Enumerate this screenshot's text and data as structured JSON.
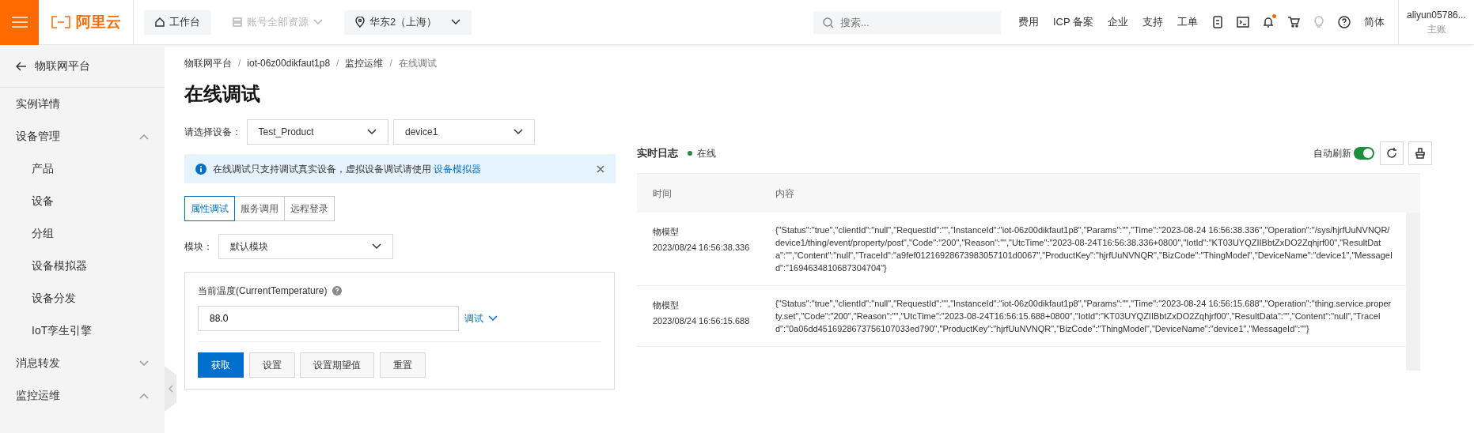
{
  "topbar": {
    "logo": "阿里云",
    "workbench": "工作台",
    "resources": {
      "label": "账号全部资源",
      "disabled": true
    },
    "region": "华东2（上海）",
    "search": {
      "placeholder": "搜索..."
    },
    "links": [
      "费用",
      "ICP 备案",
      "企业",
      "支持",
      "工单"
    ],
    "icons": [
      {
        "kind": "app",
        "dot": false
      },
      {
        "kind": "terminal",
        "dot": false
      },
      {
        "kind": "bell",
        "dot": true
      },
      {
        "kind": "cart",
        "dot": false
      },
      {
        "kind": "bulb",
        "dot": false
      },
      {
        "kind": "help",
        "dot": false
      }
    ],
    "language": "简体",
    "user": {
      "name": "aliyun05786...",
      "role": "主账"
    }
  },
  "sidebar": {
    "back": "物联网平台",
    "items": [
      {
        "label": "实例详情",
        "kind": "link"
      },
      {
        "label": "设备管理",
        "kind": "group",
        "expanded": true,
        "children": [
          {
            "label": "产品"
          },
          {
            "label": "设备"
          },
          {
            "label": "分组"
          },
          {
            "label": "设备模拟器"
          },
          {
            "label": "设备分发"
          },
          {
            "label": "IoT孪生引擎"
          }
        ]
      },
      {
        "label": "消息转发",
        "kind": "group",
        "expanded": false
      },
      {
        "label": "监控运维",
        "kind": "group",
        "expanded": true
      }
    ]
  },
  "breadcrumb": {
    "separator": "/",
    "items": [
      "物联网平台",
      "iot-06z00dikfaut1p8",
      "监控运维",
      "在线调试"
    ]
  },
  "title": "在线调试",
  "device_select": {
    "label": "请选择设备：",
    "product": "Test_Product",
    "device": "device1"
  },
  "alert": {
    "text": "在线调试只支持调试真实设备，虚拟设备调试请使用",
    "link": "设备模拟器"
  },
  "tabs": [
    {
      "label": "属性调试",
      "selected": true
    },
    {
      "label": "服务调用",
      "selected": false
    },
    {
      "label": "远程登录",
      "selected": false
    }
  ],
  "module": {
    "label": "模块：",
    "value": "默认模块"
  },
  "property": {
    "label": "当前温度(CurrentTemperature)",
    "value": "88.0",
    "debug": "调试",
    "buttons": [
      {
        "label": "获取",
        "primary": true
      },
      {
        "label": "设置",
        "primary": false
      },
      {
        "label": "设置期望值",
        "primary": false
      },
      {
        "label": "重置",
        "primary": false
      }
    ]
  },
  "log": {
    "title": "实时日志",
    "status": {
      "text": "在线",
      "color": "#1e8e3e"
    },
    "auto_refresh": {
      "label": "自动刷新",
      "on": true
    },
    "columns": [
      "时间",
      "内容"
    ],
    "rows": [
      {
        "type": "物模型",
        "time": "2023/08/24 16:56:38.336",
        "content": "{\"Status\":\"true\",\"clientId\":\"null\",\"RequestId\":\"\",\"InstanceId\":\"iot-06z00dikfaut1p8\",\"Params\":\"\",\"Time\":\"2023-08-24 16:56:38.336\",\"Operation\":\"/sys/hjrfUuNVNQR/device1/thing/event/property/post\",\"Code\":\"200\",\"Reason\":\"\",\"UtcTime\":\"2023-08-24T16:56:38.336+0800\",\"IotId\":\"KT03UYQZIIBbtZxDO2Zqhjrf00\",\"ResultData\":\"\",\"Content\":\"null\",\"TraceId\":\"a9fef01216928673983057101d0067\",\"ProductKey\":\"hjrfUuNVNQR\",\"BizCode\":\"ThingModel\",\"DeviceName\":\"device1\",\"MessageId\":\"1694634810687304704\"}"
      },
      {
        "type": "物模型",
        "time": "2023/08/24 16:56:15.688",
        "content": "{\"Status\":\"true\",\"clientId\":\"null\",\"RequestId\":\"\",\"InstanceId\":\"iot-06z00dikfaut1p8\",\"Params\":\"\",\"Time\":\"2023-08-24 16:56:15.688\",\"Operation\":\"thing.service.property.set\",\"Code\":\"200\",\"Reason\":\"\",\"UtcTime\":\"2023-08-24T16:56:15.688+0800\",\"IotId\":\"KT03UYQZIIBbtZxDO2Zqhjrf00\",\"ResultData\":\"\",\"Content\":\"null\",\"TraceId\":\"0a06dd4516928673756107033ed790\",\"ProductKey\":\"hjrfUuNVNQR\",\"BizCode\":\"ThingModel\",\"DeviceName\":\"device1\",\"MessageId\":\"\"}"
      }
    ]
  }
}
